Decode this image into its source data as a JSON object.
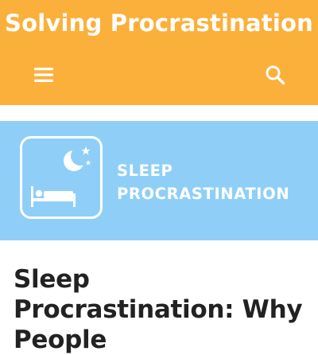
{
  "header": {
    "site_title": "Solving Procrastination",
    "background_color": "#fbb03b",
    "menu_icon": "hamburger-menu-icon",
    "search_icon": "search-icon"
  },
  "banner": {
    "background_color": "#8fcff7",
    "icon": "sleep-bed-moon-icon",
    "title_line1": "SLEEP",
    "title_line2": "PROCRASTINATION"
  },
  "article": {
    "title": "Sleep Procrastination: Why People"
  }
}
